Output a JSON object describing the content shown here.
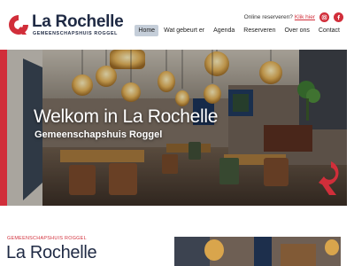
{
  "brand": {
    "title": "La Rochelle",
    "subtitle": "GEMEENSCHAPSHUIS ROGGEL",
    "accent_color": "#d12e3a",
    "navy_color": "#1f2a44"
  },
  "topbar": {
    "reserve_text": "Online reserveren?",
    "reserve_link": "Klik hier",
    "social_icons": [
      "instagram-icon",
      "facebook-icon"
    ]
  },
  "nav": {
    "items": [
      {
        "label": "Home",
        "active": true
      },
      {
        "label": "Wat gebeurt er",
        "active": false
      },
      {
        "label": "Agenda",
        "active": false
      },
      {
        "label": "Reserveren",
        "active": false
      },
      {
        "label": "Over ons",
        "active": false
      },
      {
        "label": "Contact",
        "active": false
      }
    ]
  },
  "hero": {
    "title": "Welkom in La Rochelle",
    "subtitle": "Gemeenschapshuis Roggel"
  },
  "section": {
    "label": "GEMEENSCHAPSHUIS ROGGEL",
    "title": "La Rochelle"
  }
}
